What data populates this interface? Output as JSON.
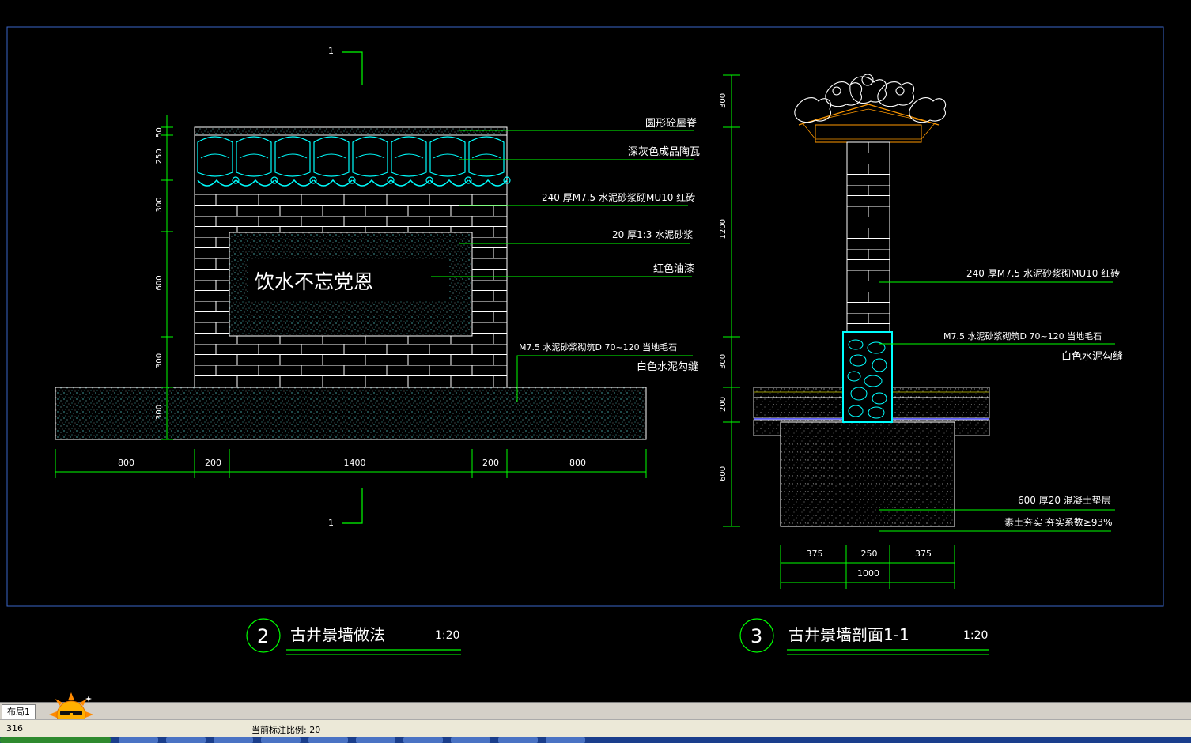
{
  "drawing": {
    "elevation": {
      "section_mark_top": "1",
      "section_mark_bottom": "1",
      "inscription": "饮水不忘党恩",
      "vertical_dims": [
        "50",
        "250",
        "300",
        "600",
        "300",
        "300"
      ],
      "horizontal_dims": [
        "800",
        "200",
        "1400",
        "200",
        "800"
      ],
      "callouts": [
        "圆形砼屋脊",
        "深灰色成品陶瓦",
        "240  厚M7.5  水泥砂浆砌MU10  红砖",
        "20  厚1:3  水泥砂浆",
        "红色油漆",
        "M7.5  水泥砂浆砌筑D 70~120    当地毛石",
        "白色水泥勾缝"
      ]
    },
    "section": {
      "vertical_dims": [
        "300",
        "1200",
        "300",
        "200",
        "600"
      ],
      "horizontal_dims": [
        "375",
        "250",
        "375"
      ],
      "total_width": "1000",
      "callouts": [
        "240  厚M7.5  水泥砂浆砌MU10  红砖",
        "M7.5  水泥砂浆砌筑D 70~120    当地毛石",
        "白色水泥勾缝",
        "600  厚20  混凝土垫层",
        "素土夯实  夯实系数≥93%"
      ]
    },
    "title_blocks": [
      {
        "number": "2",
        "title": "古井景墙做法",
        "scale": "1:20"
      },
      {
        "number": "3",
        "title": "古井景墙剖面1-1",
        "scale": "1:20"
      }
    ]
  },
  "layout_tab": "布局1",
  "status_bar": {
    "coordinate": "316",
    "annotation_scale": "当前标注比例: 20"
  },
  "icons": [
    "sun-mascot-icon"
  ],
  "colors": {
    "background": "#000000",
    "frame": "#3a66c8",
    "dim_line": "#00c800",
    "outline": "#ffffff",
    "hatch": "#00e5ff",
    "roof": "#ff9900"
  }
}
